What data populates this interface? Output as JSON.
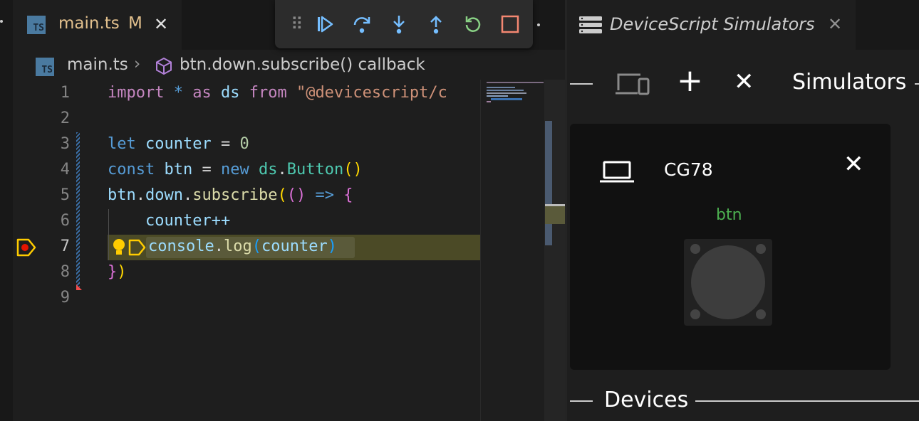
{
  "editor": {
    "tab": {
      "badge": "TS",
      "filename": "main.ts",
      "status": "M",
      "close": "✕"
    },
    "breadcrumb": {
      "badge": "TS",
      "file": "main.ts",
      "separator": "›",
      "symbol": "btn.down.subscribe() callback"
    },
    "line_numbers": [
      "1",
      "2",
      "3",
      "4",
      "5",
      "6",
      "7",
      "8",
      "9"
    ],
    "current_line": 7,
    "code": {
      "l1": {
        "import": "import",
        "star": " * ",
        "as": "as",
        "ds": " ds ",
        "from": "from",
        "str": " \"@devicescript/c"
      },
      "l3": {
        "let": "let",
        "counter": " counter",
        "eq": " = ",
        "zero": "0"
      },
      "l4": {
        "const": "const",
        "btn": " btn",
        "eq": " = ",
        "new": "new",
        "ds": " ds",
        "dot": ".",
        "Button": "Button",
        "paren": "()"
      },
      "l5": {
        "btn": "btn",
        "dot1": ".",
        "down": "down",
        "dot2": ".",
        "subscribe": "subscribe",
        "open": "(",
        "p": "()",
        "arrow": " => ",
        "brace": "{"
      },
      "l6": {
        "text": "    counter++"
      },
      "l7": {
        "console": "console",
        "dot": ".",
        "log": "log",
        "open": "(",
        "arg": "counter",
        "close": ")"
      },
      "l8": {
        "brace": "}",
        "paren": ")"
      }
    }
  },
  "debug_toolbar": {
    "grip": "⠿",
    "buttons": [
      "continue",
      "step-over",
      "step-into",
      "step-out",
      "restart",
      "stop"
    ]
  },
  "simulators_panel": {
    "tab_label": "DeviceScript Simulators",
    "tab_close": "✕",
    "heading": "Simulators",
    "toolbar": {
      "add": "+",
      "close": "✕"
    },
    "device": {
      "name": "CG78",
      "close": "✕",
      "button_label": "btn"
    },
    "devices_heading": "Devices"
  },
  "colors": {
    "accent_blue": "#75beff",
    "debug_green": "#89d185",
    "debug_red": "#f48771",
    "breakpoint_yellow": "#ffcc00"
  }
}
